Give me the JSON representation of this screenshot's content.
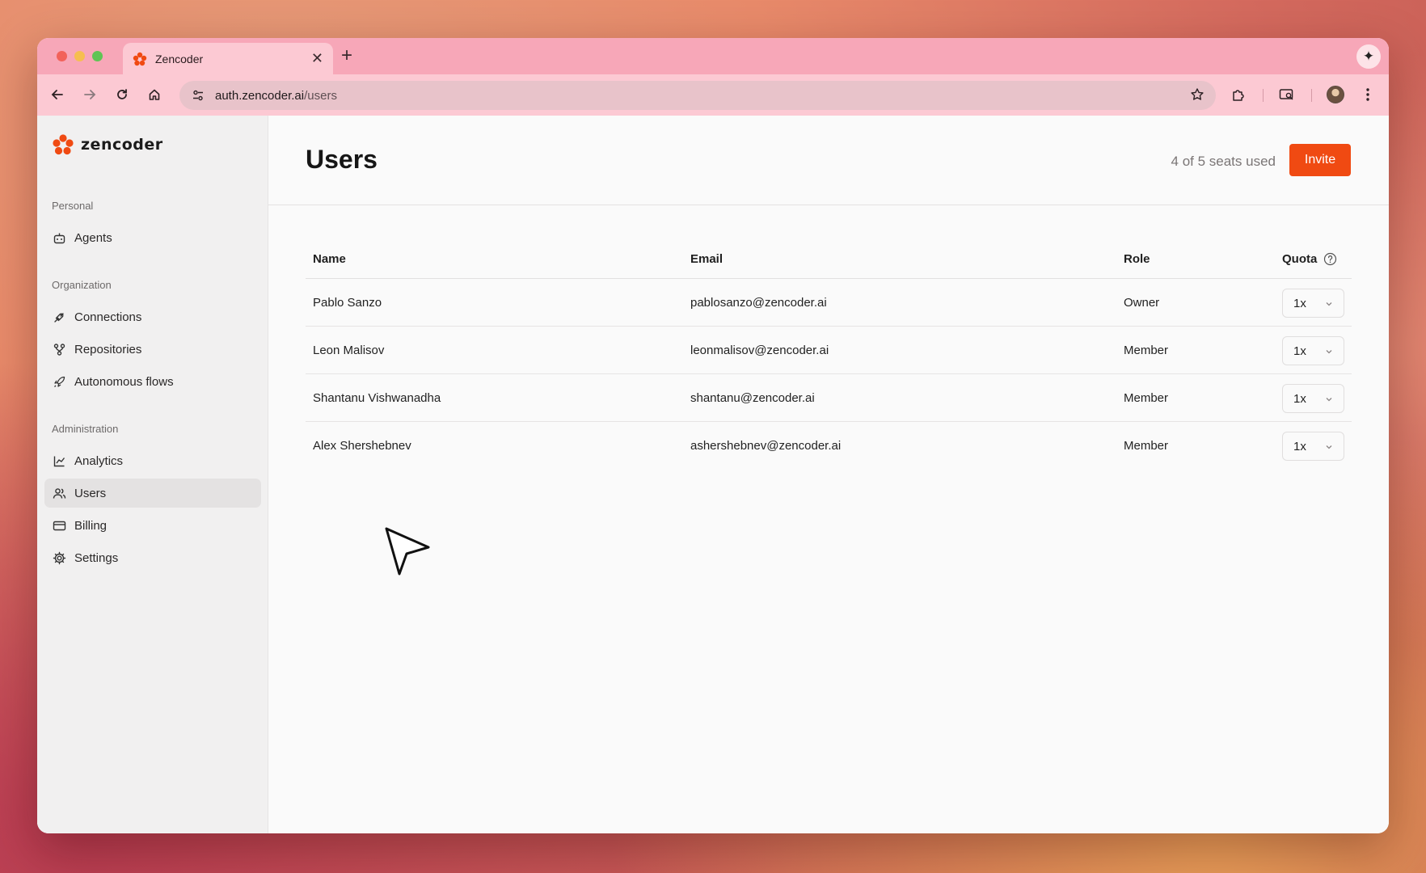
{
  "browser": {
    "tab_title": "Zencoder",
    "url_host": "auth.zencoder.ai",
    "url_path": "/users"
  },
  "app": {
    "brand": "zencoder",
    "accent_color": "#f04a12"
  },
  "sidebar": {
    "sections": [
      {
        "label": "Personal",
        "items": [
          {
            "label": "Agents",
            "icon": "robot-icon"
          }
        ]
      },
      {
        "label": "Organization",
        "items": [
          {
            "label": "Connections",
            "icon": "plug-icon"
          },
          {
            "label": "Repositories",
            "icon": "git-branch-icon"
          },
          {
            "label": "Autonomous flows",
            "icon": "rocket-icon"
          }
        ]
      },
      {
        "label": "Administration",
        "items": [
          {
            "label": "Analytics",
            "icon": "chart-line-icon"
          },
          {
            "label": "Users",
            "icon": "users-icon",
            "active": true
          },
          {
            "label": "Billing",
            "icon": "credit-card-icon"
          },
          {
            "label": "Settings",
            "icon": "gear-icon"
          }
        ]
      }
    ]
  },
  "page": {
    "title": "Users",
    "seats_text": "4 of 5 seats used",
    "invite_label": "Invite"
  },
  "table": {
    "headers": {
      "name": "Name",
      "email": "Email",
      "role": "Role",
      "quota": "Quota"
    },
    "rows": [
      {
        "name": "Pablo Sanzo",
        "email": "pablosanzo@zencoder.ai",
        "role": "Owner",
        "quota": "1x"
      },
      {
        "name": "Leon Malisov",
        "email": "leonmalisov@zencoder.ai",
        "role": "Member",
        "quota": "1x"
      },
      {
        "name": "Shantanu Vishwanadha",
        "email": "shantanu@zencoder.ai",
        "role": "Member",
        "quota": "1x"
      },
      {
        "name": "Alex Shershebnev",
        "email": "ashershebnev@zencoder.ai",
        "role": "Member",
        "quota": "1x"
      }
    ]
  }
}
